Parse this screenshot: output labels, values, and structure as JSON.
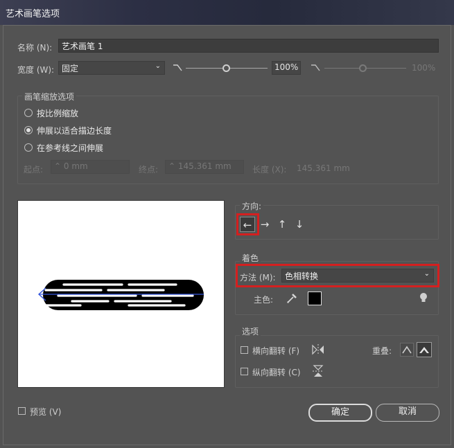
{
  "window": {
    "title": "艺术画笔选项"
  },
  "name_row": {
    "label": "名称 (N):",
    "value": "艺术画笔 1"
  },
  "width_row": {
    "label": "宽度 (W):",
    "select_value": "固定",
    "percent_value": "100%",
    "percent_value_disabled": "100%",
    "slider_level": 0.5
  },
  "scale_group": {
    "title": "画笔缩放选项",
    "options": [
      "按比例缩放",
      "伸展以适合描边长度",
      "在参考线之间伸展"
    ],
    "selected_index": 1,
    "start_label": "起点:",
    "start_value": "0 mm",
    "end_label": "终点:",
    "end_value": "145.361 mm",
    "length_label": "长度 (X):",
    "length_value": "145.361 mm"
  },
  "direction": {
    "title": "方向:",
    "arrows": [
      "←",
      "→",
      "↑",
      "↓"
    ],
    "selected_index": 0
  },
  "colorize": {
    "title": "着色",
    "method_label": "方法 (M):",
    "method_value": "色相转换",
    "key_color_label": "主色:",
    "key_color": "#000000"
  },
  "options": {
    "title": "选项",
    "flip_along_label": "横向翻转 (F)",
    "flip_across_label": "纵向翻转 (C)",
    "overlap_label": "重叠:"
  },
  "footer": {
    "preview_label": "预览 (V)",
    "ok_label": "确定",
    "cancel_label": "取消"
  },
  "colors": {
    "highlight": "#d51f1f",
    "dialog_bg": "#535353",
    "brush_fill": "#000000",
    "guide_line": "#3355dd"
  }
}
